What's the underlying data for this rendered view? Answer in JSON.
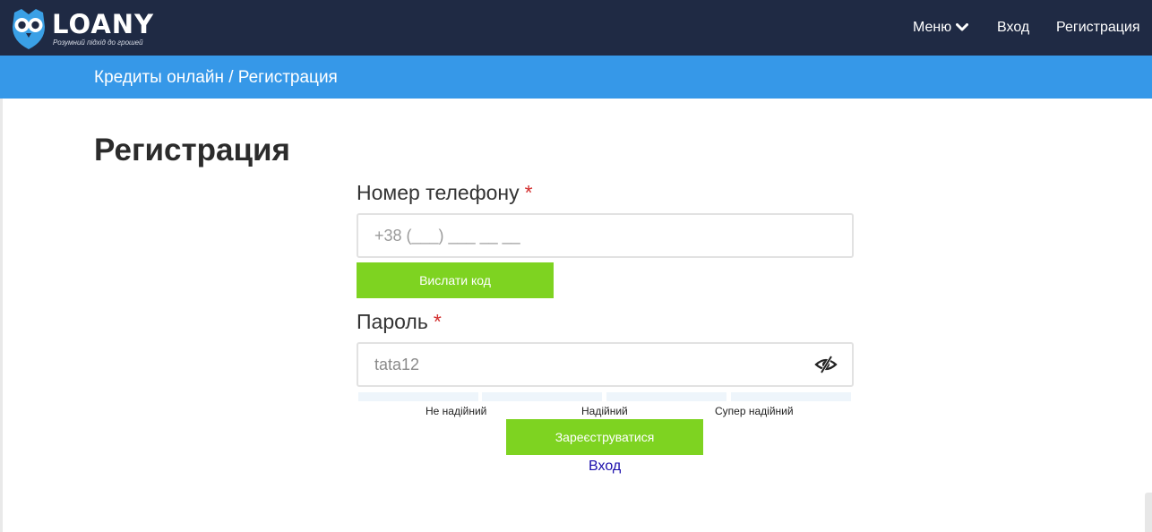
{
  "brand": {
    "name": "LOANY",
    "slogan": "Розумний підхід до грошей",
    "colors": {
      "nav_bg": "#1f2a44",
      "crumb_bg": "#3698e8",
      "accent_green": "#7ed321",
      "logo_blue": "#3aa0e6"
    }
  },
  "nav": {
    "menu_label": "Меню",
    "menu_icon": "chevron-down-icon",
    "login_label": "Вход",
    "register_label": "Регистрация"
  },
  "breadcrumb": {
    "text": "Кредиты онлайн / Регистрация"
  },
  "page": {
    "title": "Регистрация"
  },
  "form": {
    "phone": {
      "label": "Номер телефону",
      "required_mark": "*",
      "placeholder": "+38 (___) ___ __ __",
      "value": ""
    },
    "send_code_label": "Вислати код",
    "password": {
      "label": "Пароль",
      "required_mark": "*",
      "value": "tata12",
      "toggle_icon": "eye-slash-icon"
    },
    "strength": {
      "levels": [
        "Не надійний",
        "Надійний",
        "Супер надійний"
      ],
      "filled_segments": 0
    },
    "submit_label": "Зареєструватися",
    "login_link": "Вход"
  }
}
